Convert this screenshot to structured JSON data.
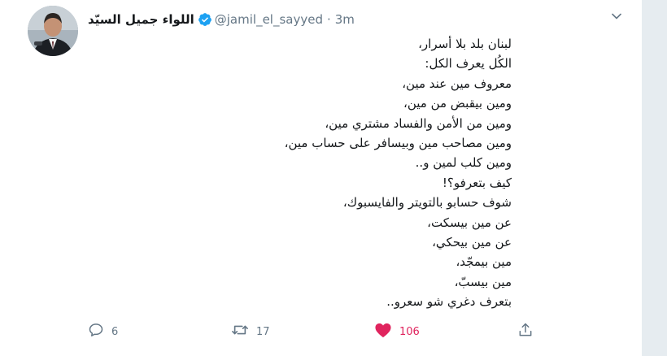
{
  "tweet": {
    "author_name": "اللواء جميل السيّد",
    "handle": "@jamil_el_sayyed",
    "separator": "·",
    "time": "3m",
    "lines": [
      "لبنان بلد بلا أسرار،",
      "الكُل يعرف الكل:",
      "معروف مين عند مين،",
      "ومين بيقبض من مين،",
      "ومين من الأمن والفساد مشتري مين،",
      "ومين مصاحب مين وبيسافر على حساب مين،",
      "ومين كلب لمين و..",
      "كيف بتعرفو؟!",
      "شوف حسابو بالتويتر والفايسبوك،",
      "عن مين بيسكت،",
      "عن مين بيحكي،",
      "مين بيمجّد،",
      "مين بيسبّ،",
      "بتعرف دغري شو سعرو.."
    ]
  },
  "actions": {
    "reply_count": "6",
    "retweet_count": "17",
    "like_count": "106"
  },
  "colors": {
    "like_active": "#e0245e",
    "verified_blue": "#1da1f2",
    "muted": "#657786"
  },
  "icons": [
    "verified-badge-icon",
    "caret-down-icon",
    "reply-icon",
    "retweet-icon",
    "heart-icon",
    "share-icon"
  ]
}
